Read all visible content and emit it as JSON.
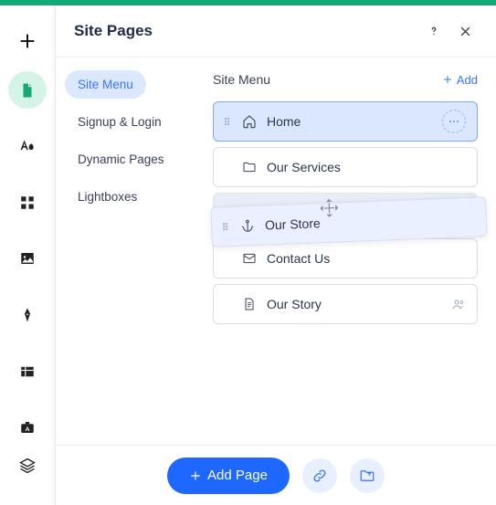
{
  "header": {
    "title": "Site Pages"
  },
  "sidemenu": {
    "items": [
      {
        "label": "Site Menu",
        "active": true
      },
      {
        "label": "Signup & Login"
      },
      {
        "label": "Dynamic Pages"
      },
      {
        "label": "Lightboxes"
      }
    ]
  },
  "content": {
    "title": "Site Menu",
    "add_label": "Add"
  },
  "pages": [
    {
      "label": "Home",
      "icon": "home",
      "selected": true,
      "more": true
    },
    {
      "label": "Our Services",
      "icon": "folder"
    },
    {
      "label": "Our Store",
      "icon": "anchor",
      "dragging": true
    },
    {
      "label": "Contact Us",
      "icon": "mail"
    },
    {
      "label": "Our Story",
      "icon": "doc",
      "badge": "members"
    }
  ],
  "footer": {
    "add_page": "Add Page"
  }
}
